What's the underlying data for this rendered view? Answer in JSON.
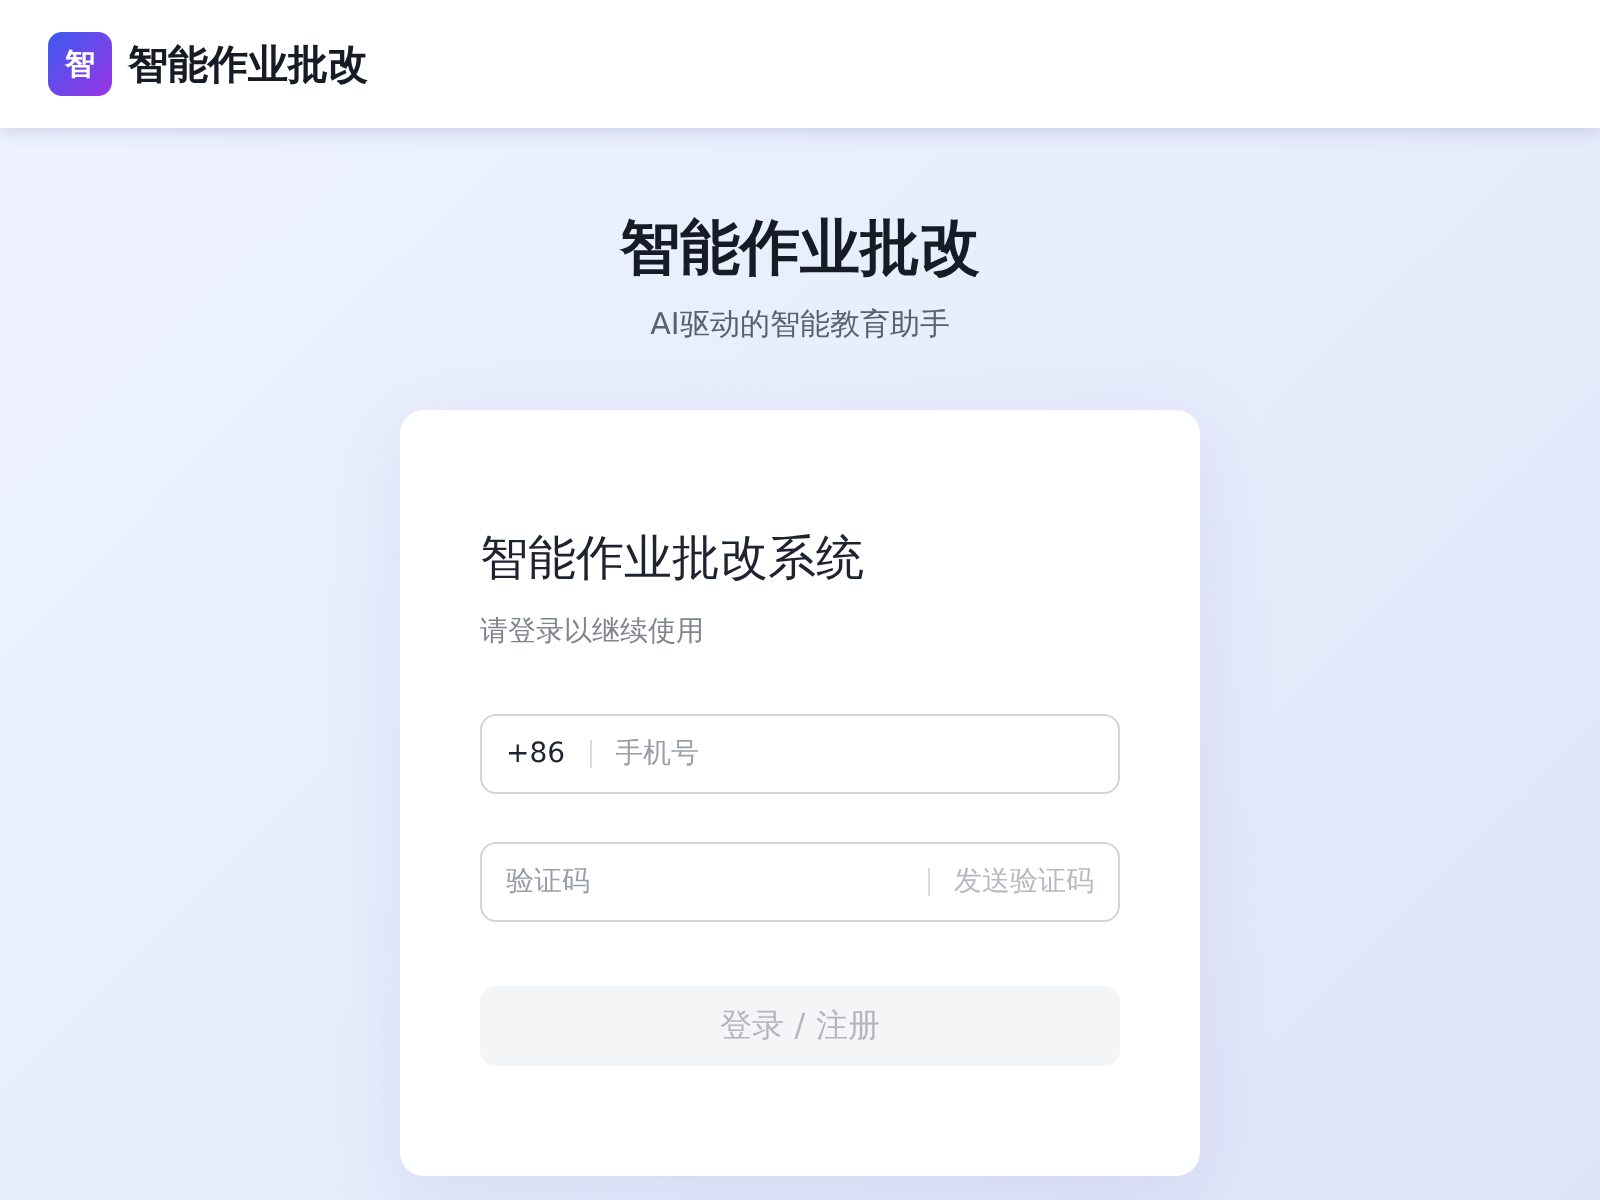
{
  "header": {
    "logo_text": "智",
    "title": "智能作业批改"
  },
  "hero": {
    "title": "智能作业批改",
    "subtitle": "AI驱动的智能教育助手"
  },
  "login_card": {
    "title": "智能作业批改系统",
    "subtitle": "请登录以继续使用",
    "phone_field": {
      "country_code": "+86",
      "placeholder": "手机号"
    },
    "code_field": {
      "placeholder": "验证码",
      "send_code": {
        "label": "发送验证码",
        "disabled": true
      }
    },
    "submit_button": {
      "label": "登录 / 注册",
      "disabled": true
    }
  }
}
